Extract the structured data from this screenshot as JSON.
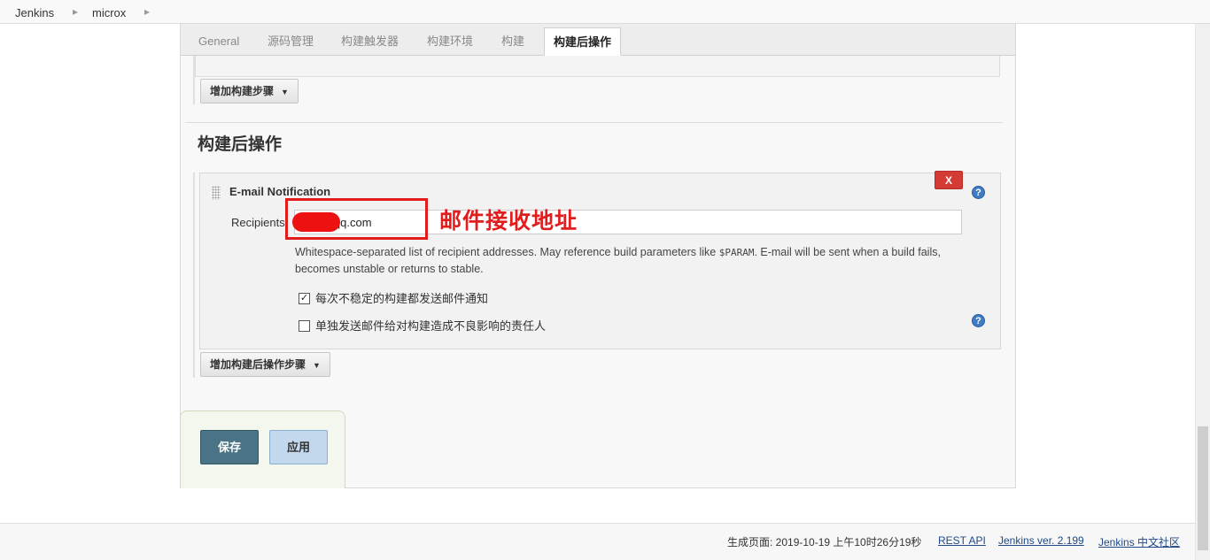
{
  "breadcrumb": {
    "items": [
      "Jenkins",
      "microx"
    ],
    "separator": "▸"
  },
  "tabs": [
    {
      "label": "General",
      "active": false
    },
    {
      "label": "源码管理",
      "active": false
    },
    {
      "label": "构建触发器",
      "active": false
    },
    {
      "label": "构建环境",
      "active": false
    },
    {
      "label": "构建",
      "active": false
    },
    {
      "label": "构建后操作",
      "active": true
    }
  ],
  "build": {
    "add_step_label": "增加构建步骤"
  },
  "post_build": {
    "heading": "构建后操作",
    "add_step_label": "增加构建后操作步骤"
  },
  "email": {
    "title": "E-mail Notification",
    "delete_label": "X",
    "recipients_label": "Recipients",
    "recipients_value": "203@qq.com",
    "description_before": "Whitespace-separated list of recipient addresses. May reference build parameters like ",
    "description_code": "$PARAM",
    "description_after": ". E-mail will be sent when a build fails, becomes unstable or returns to stable.",
    "checkbox_unstable": {
      "label": "每次不稳定的构建都发送邮件通知",
      "checked": true
    },
    "checkbox_individual": {
      "label": "单独发送邮件给对构建造成不良影响的责任人",
      "checked": false
    },
    "help_symbol": "?"
  },
  "annotation": {
    "text": "邮件接收地址",
    "color": "#e11d1d"
  },
  "actions": {
    "save_label": "保存",
    "apply_label": "应用"
  },
  "footer": {
    "generated_text": "生成页面: 2019-10-19 上午10时26分19秒",
    "rest_api_label": "REST API",
    "version_label": "Jenkins ver. 2.199",
    "community_label": "Jenkins 中文社区"
  },
  "colors": {
    "save_button": "#4a7485",
    "apply_button": "#c3d8ec",
    "delete_button": "#d33b34",
    "help_icon": "#3e7cc6",
    "link": "#204a87"
  }
}
